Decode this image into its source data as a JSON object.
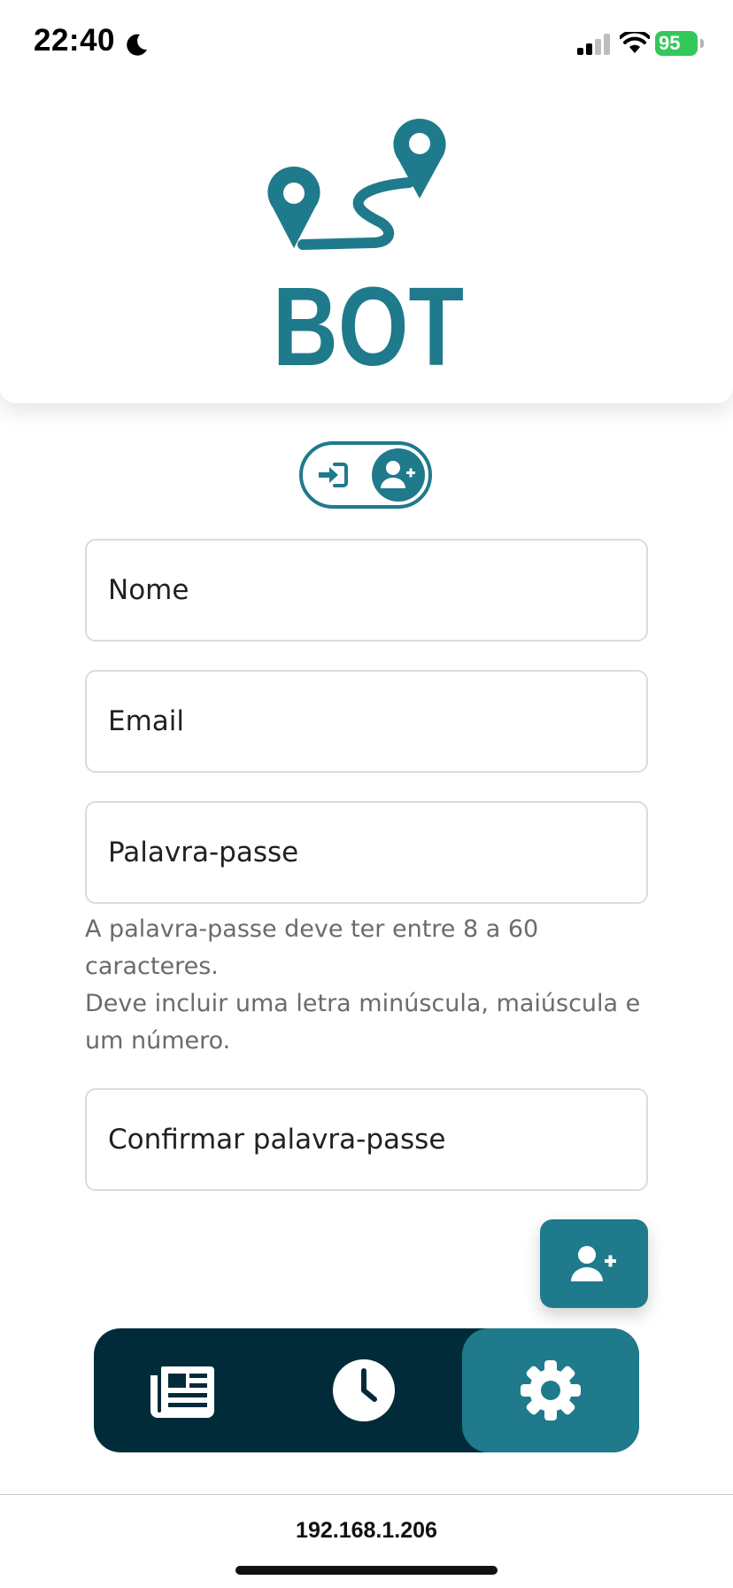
{
  "status_bar": {
    "time": "22:40",
    "battery": "95"
  },
  "header": {
    "logo_text": "BOT"
  },
  "form": {
    "name_placeholder": "Nome",
    "email_placeholder": "Email",
    "password_placeholder": "Palavra-passe",
    "password_hint_line1": "A palavra-passe deve ter entre 8 a 60 caracteres.",
    "password_hint_line2": "Deve incluir uma letra minúscula, maiúscula e um número.",
    "confirm_placeholder": "Confirmar palavra-passe"
  },
  "browser": {
    "url": "192.168.1.206"
  },
  "colors": {
    "primary": "#1f7a8c",
    "nav_background": "#022b3a",
    "battery": "#34c759"
  },
  "icons": {
    "toggle_login": "sign-in-icon",
    "toggle_register": "user-plus-icon",
    "fab": "user-plus-icon",
    "nav_news": "newspaper-icon",
    "nav_history": "clock-icon",
    "nav_settings": "gear-icon"
  }
}
